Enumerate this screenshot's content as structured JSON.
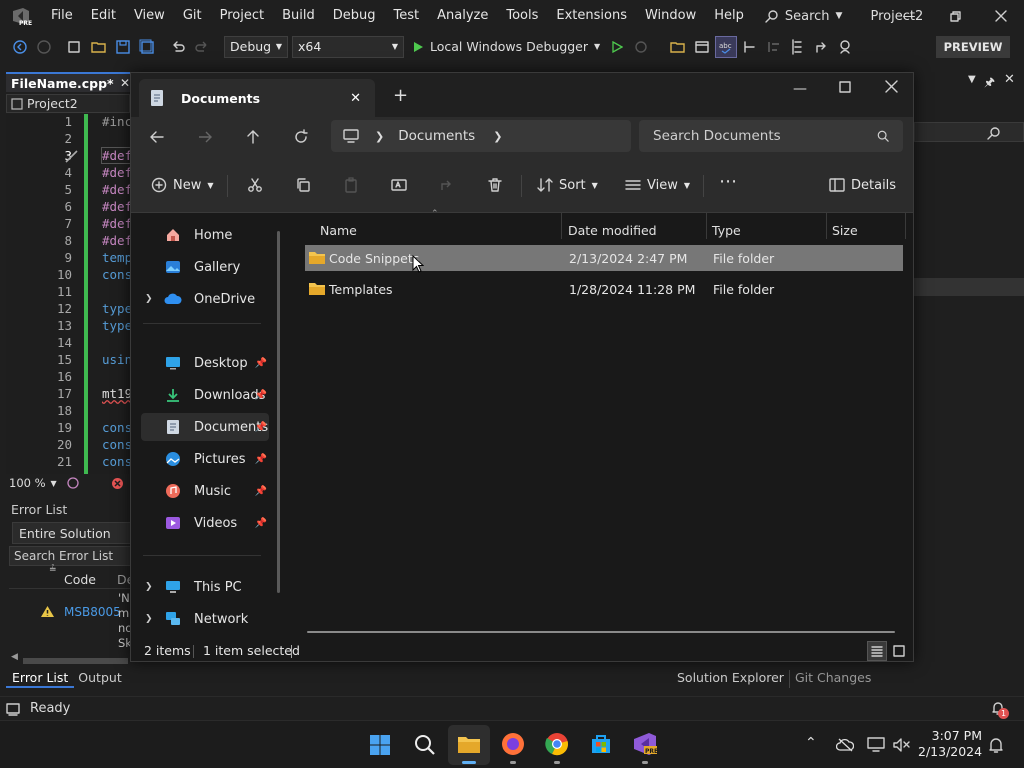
{
  "vs": {
    "menu": [
      "File",
      "Edit",
      "View",
      "Git",
      "Project",
      "Build",
      "Debug",
      "Test",
      "Analyze",
      "Tools",
      "Extensions",
      "Window",
      "Help"
    ],
    "search_label": "Search",
    "title": "Project2",
    "config": "Debug",
    "platform": "x64",
    "debugger": "Local Windows Debugger",
    "preview_badge": "PREVIEW",
    "editor_tab": "FileName.cpp*",
    "editor_project": "Project2",
    "line_numbers": [
      "1",
      "2",
      "3",
      "4",
      "5",
      "6",
      "7",
      "8",
      "9",
      "10",
      "11",
      "12",
      "13",
      "14",
      "15",
      "16",
      "17",
      "18",
      "19",
      "20",
      "21"
    ],
    "code_lines": [
      "#inc",
      "",
      "#def",
      "#def",
      "#def",
      "#def",
      "#def",
      "#def",
      "temp",
      "cons",
      "",
      "type",
      "type",
      "",
      "usin",
      "",
      "mt19",
      "",
      "cons",
      "cons",
      "cons"
    ],
    "zoom": "100 %",
    "error_list": {
      "title": "Error List",
      "scope": "Entire Solution",
      "search_placeholder": "Search Error List",
      "col_code": "Code",
      "col_desc": "De",
      "error_code": "MSB8005",
      "error_desc": [
        "'NM",
        "mr",
        "not",
        "Ski"
      ]
    },
    "bottom_tabs": [
      "Error List",
      "Output"
    ],
    "right_tabs": [
      "Solution Explorer",
      "Git Changes"
    ],
    "status": "Ready"
  },
  "explorer": {
    "tab_title": "Documents",
    "address_segment": "Documents",
    "search_placeholder": "Search Documents",
    "commands": {
      "new": "New",
      "sort": "Sort",
      "view": "View",
      "details": "Details"
    },
    "sidebar": [
      {
        "label": "Home",
        "icon": "home-icon"
      },
      {
        "label": "Gallery",
        "icon": "gallery-icon"
      },
      {
        "label": "OneDrive",
        "icon": "onedrive-icon"
      },
      {
        "label": "Desktop",
        "icon": "desktop-icon"
      },
      {
        "label": "Downloads",
        "icon": "downloads-icon"
      },
      {
        "label": "Documents",
        "icon": "documents-icon"
      },
      {
        "label": "Pictures",
        "icon": "pictures-icon"
      },
      {
        "label": "Music",
        "icon": "music-icon"
      },
      {
        "label": "Videos",
        "icon": "videos-icon"
      },
      {
        "label": "This PC",
        "icon": "this-pc-icon"
      },
      {
        "label": "Network",
        "icon": "network-icon"
      }
    ],
    "columns": [
      "Name",
      "Date modified",
      "Type",
      "Size"
    ],
    "files": [
      {
        "name": "Code Snippets",
        "date": "2/13/2024 2:47 PM",
        "type": "File folder",
        "size": ""
      },
      {
        "name": "Templates",
        "date": "1/28/2024 11:28 PM",
        "type": "File folder",
        "size": ""
      }
    ],
    "status_items": "2 items",
    "status_selected": "1 item selected"
  },
  "taskbar": {
    "time": "3:07 PM",
    "date": "2/13/2024",
    "notification_count": "1"
  },
  "colors": {
    "accent": "#3b78d6",
    "selected_row": "#777777",
    "folder": "#f4c44e",
    "vs_purple": "#8f5ad8"
  }
}
